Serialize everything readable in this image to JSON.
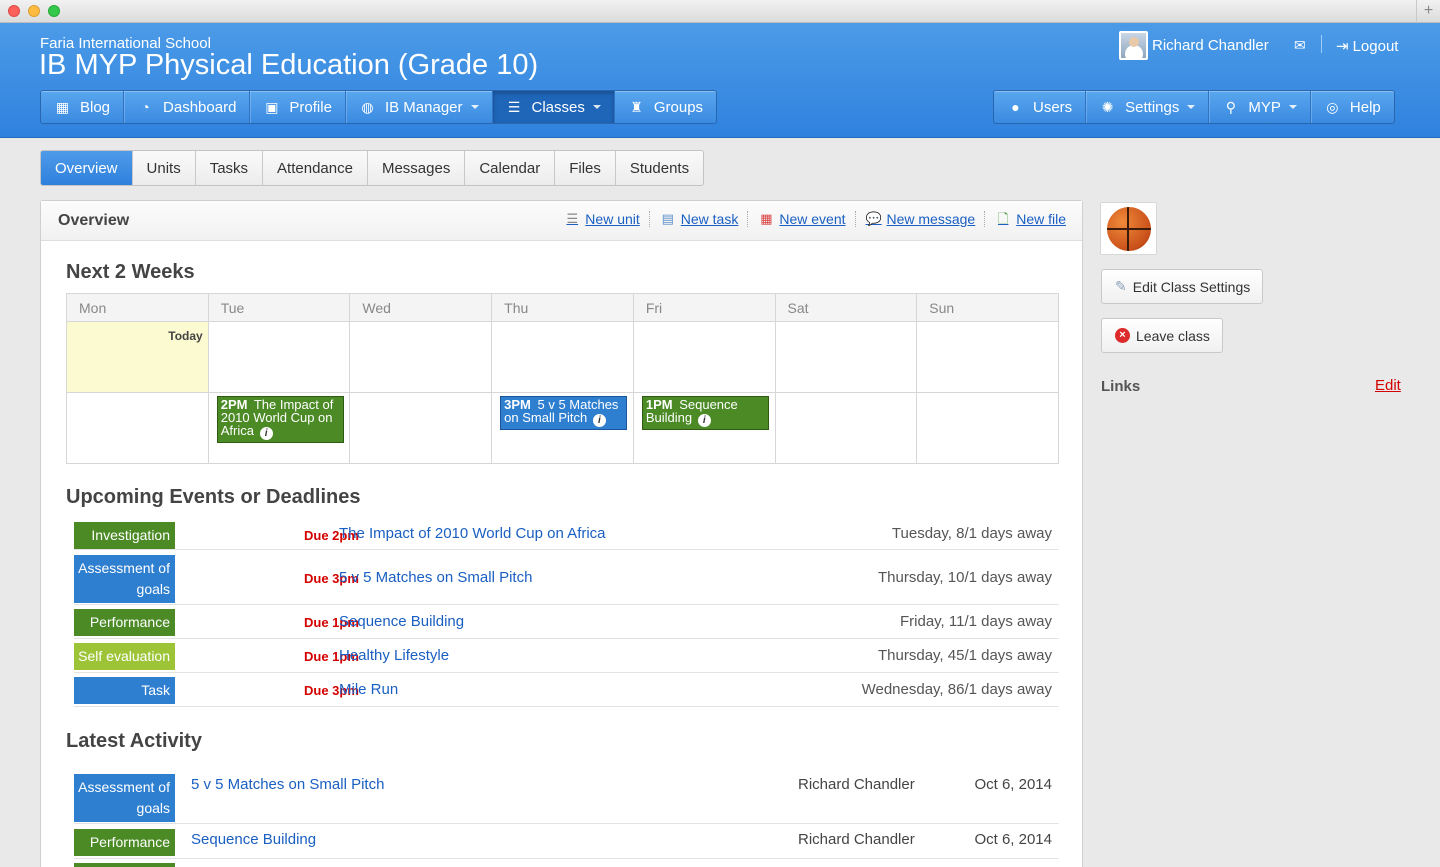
{
  "header": {
    "school": "Faria International School",
    "course": "IB MYP Physical Education (Grade 10)",
    "user_name": "Richard Chandler",
    "logout_label": "Logout",
    "nav_left": [
      {
        "label": "Blog",
        "icon": "blog-icon"
      },
      {
        "label": "Dashboard",
        "icon": "dashboard-icon"
      },
      {
        "label": "Profile",
        "icon": "profile-icon"
      },
      {
        "label": "IB Manager",
        "icon": "globe-icon",
        "dropdown": true
      },
      {
        "label": "Classes",
        "icon": "classes-icon",
        "dropdown": true,
        "active": true
      },
      {
        "label": "Groups",
        "icon": "trophy-icon"
      }
    ],
    "nav_right": [
      {
        "label": "Users",
        "icon": "user-icon"
      },
      {
        "label": "Settings",
        "icon": "gear-icon",
        "dropdown": true
      },
      {
        "label": "MYP",
        "icon": "search-icon",
        "dropdown": true
      },
      {
        "label": "Help",
        "icon": "lifebuoy-icon"
      }
    ]
  },
  "subtabs": [
    "Overview",
    "Units",
    "Tasks",
    "Attendance",
    "Messages",
    "Calendar",
    "Files",
    "Students"
  ],
  "active_subtab": "Overview",
  "overview": {
    "title": "Overview",
    "actions": [
      {
        "label": "New unit",
        "icon": "unit-icon"
      },
      {
        "label": "New task",
        "icon": "task-icon"
      },
      {
        "label": "New event",
        "icon": "calendar-icon"
      },
      {
        "label": "New message",
        "icon": "message-icon"
      },
      {
        "label": "New file",
        "icon": "file-icon"
      }
    ]
  },
  "calendar": {
    "title": "Next 2 Weeks",
    "days": [
      "Mon",
      "Tue",
      "Wed",
      "Thu",
      "Fri",
      "Sat",
      "Sun"
    ],
    "today_label": "Today",
    "events": [
      {
        "time": "2PM",
        "title": "The Impact of 2010 World Cup on Africa",
        "day": "Tue",
        "week": 2,
        "color": "#4b8a25"
      },
      {
        "time": "3PM",
        "title": "5 v 5 Matches on Small Pitch",
        "day": "Thu",
        "week": 2,
        "color": "#2f7fd0"
      },
      {
        "time": "1PM",
        "title": "Sequence Building",
        "day": "Fri",
        "week": 2,
        "color": "#4b8a25"
      }
    ]
  },
  "upcoming": {
    "title": "Upcoming Events or Deadlines",
    "items": [
      {
        "type": "Investigation",
        "due": "Due 2pm",
        "title": "The Impact of 2010 World Cup on Africa",
        "date": "Tuesday, 8/1 days away",
        "color": "#4b8a25"
      },
      {
        "type": "Assessment of goals",
        "due": "Due 3pm",
        "title": "5 v 5 Matches on Small Pitch",
        "date": "Thursday, 10/1 days away",
        "color": "#2f7fd0"
      },
      {
        "type": "Performance",
        "due": "Due 1pm",
        "title": "Sequence Building",
        "date": "Friday, 11/1 days away",
        "color": "#4b8a25"
      },
      {
        "type": "Self evaluation",
        "due": "Due 1pm",
        "title": "Healthy Lifestyle",
        "date": "Thursday, 45/1 days away",
        "color": "#9dc436"
      },
      {
        "type": "Task",
        "due": "Due 3pm",
        "title": "Mile Run",
        "date": "Wednesday, 86/1 days away",
        "color": "#2f7fd0"
      }
    ]
  },
  "activity": {
    "title": "Latest Activity",
    "items": [
      {
        "type": "Assessment of goals",
        "title": "5 v 5 Matches on Small Pitch",
        "user": "Richard Chandler",
        "date": "Oct 6, 2014",
        "color": "#2f7fd0"
      },
      {
        "type": "Performance",
        "title": "Sequence Building",
        "user": "Richard Chandler",
        "date": "Oct 6, 2014",
        "color": "#4b8a25"
      }
    ]
  },
  "sidebar": {
    "class_image": "basketball-icon",
    "edit_settings_label": "Edit Class Settings",
    "leave_label": "Leave class",
    "links_title": "Links",
    "links_edit": "Edit"
  }
}
